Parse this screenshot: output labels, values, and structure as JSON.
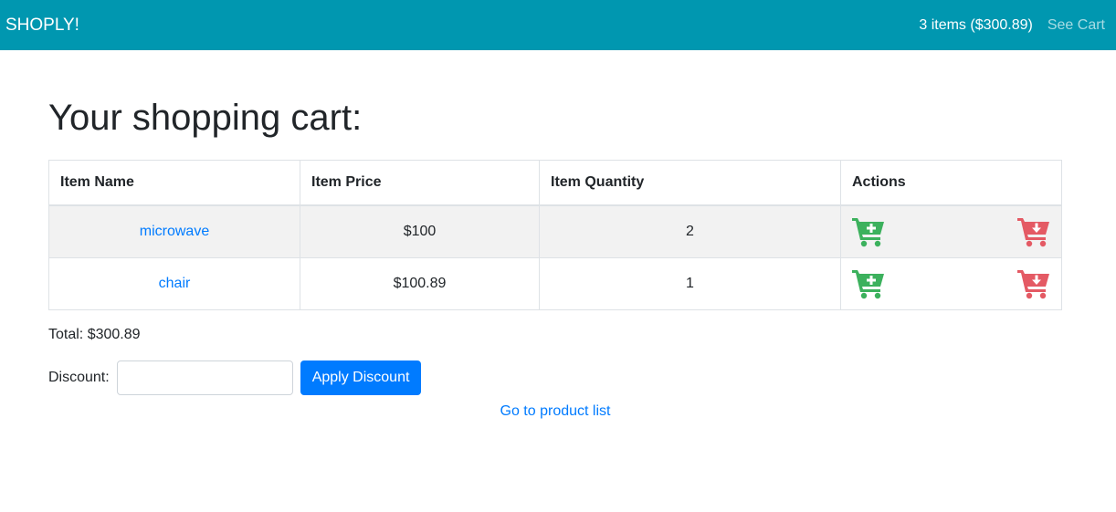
{
  "navbar": {
    "brand": "SHOPLY!",
    "cart_summary": "3 items ($300.89)",
    "see_cart": "See Cart"
  },
  "page_title": "Your shopping cart:",
  "table": {
    "headers": [
      "Item Name",
      "Item Price",
      "Item Quantity",
      "Actions"
    ],
    "rows": [
      {
        "name": "microwave",
        "price": "$100",
        "quantity": "2"
      },
      {
        "name": "chair",
        "price": "$100.89",
        "quantity": "1"
      }
    ],
    "actions": {
      "add_icon": "cart-plus-icon",
      "remove_icon": "cart-arrow-down-icon"
    }
  },
  "total": "Total: $300.89",
  "discount": {
    "label": "Discount:",
    "value": "",
    "placeholder": "",
    "button": "Apply Discount"
  },
  "go_link": "Go to product list",
  "colors": {
    "navbar": "#0097b0",
    "link": "#007bff",
    "add": "#3cb15d",
    "remove": "#e45a64",
    "button": "#007bff"
  }
}
